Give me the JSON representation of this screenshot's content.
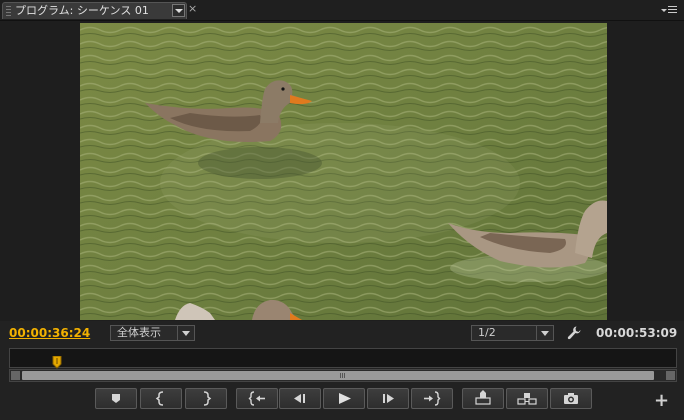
{
  "tab": {
    "label": "プログラム: シーケンス 01",
    "close_glyph": "×"
  },
  "monitor": {
    "current_time": "00:00:36:24",
    "zoom_select": {
      "selected": "全体表示"
    },
    "resolution_select": {
      "selected": "1/2"
    },
    "duration": "00:00:53:09"
  },
  "timeline": {
    "playhead_position_fraction": 0.07
  },
  "transport": {
    "buttons": [
      {
        "name": "add-marker",
        "icon": "marker-icon"
      },
      {
        "name": "mark-in",
        "icon": "mark-in-icon"
      },
      {
        "name": "mark-out",
        "icon": "mark-out-icon"
      },
      {
        "name": "go-to-in",
        "icon": "go-to-in-icon"
      },
      {
        "name": "step-back",
        "icon": "step-back-icon"
      },
      {
        "name": "play",
        "icon": "play-icon"
      },
      {
        "name": "step-forward",
        "icon": "step-forward-icon"
      },
      {
        "name": "go-to-out",
        "icon": "go-to-out-icon"
      },
      {
        "name": "lift",
        "icon": "lift-icon"
      },
      {
        "name": "extract",
        "icon": "extract-icon"
      },
      {
        "name": "export-frame",
        "icon": "camera-icon"
      }
    ],
    "add_glyph": "+"
  },
  "colors": {
    "timecode_accent": "#f2b100",
    "panel_bg": "#222222"
  }
}
